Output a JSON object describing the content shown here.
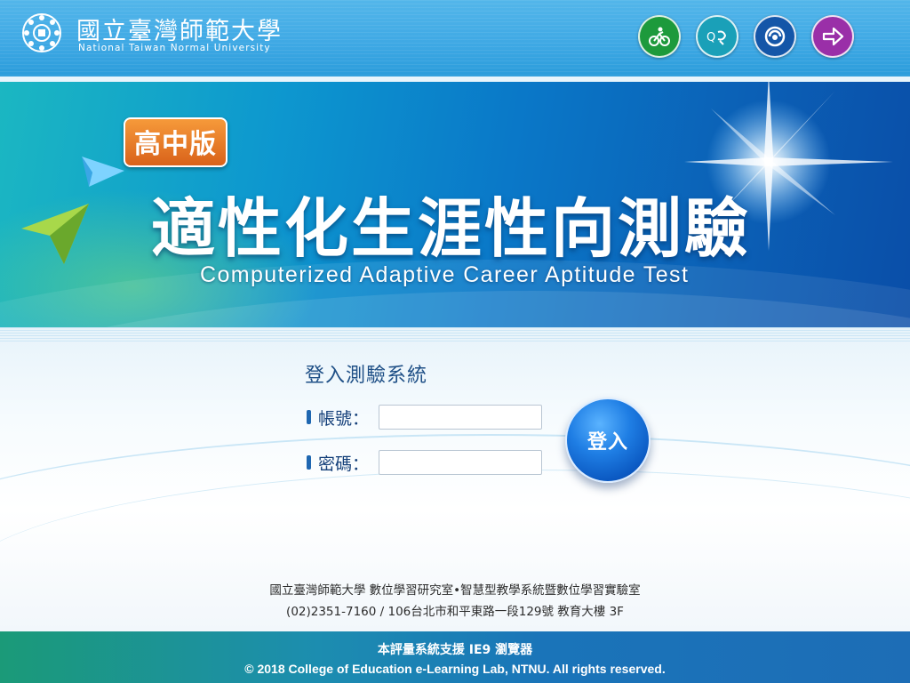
{
  "header": {
    "university_name_zh": "國立臺灣師範大學",
    "university_name_en": "National Taiwan Normal University",
    "nav_icons": [
      {
        "name": "green-circle-icon",
        "color": "#1d9a3c"
      },
      {
        "name": "teal-circle-icon",
        "color": "#1aa0b8"
      },
      {
        "name": "blue-circle-icon",
        "color": "#1456a8"
      },
      {
        "name": "purple-arrow-icon",
        "color": "#9a2fa8"
      }
    ]
  },
  "banner": {
    "edition_badge": "高中版",
    "title_zh": "適性化生涯性向測驗",
    "title_en": "Computerized Adaptive Career Aptitude Test"
  },
  "login": {
    "heading": "登入測驗系統",
    "account_label": "帳號：",
    "account_value": "",
    "password_label": "密碼：",
    "password_value": "",
    "submit_label": "登入"
  },
  "contact": {
    "organization": "國立臺灣師範大學 數位學習研究室•智慧型教學系統暨數位學習實驗室",
    "address": "(02)2351-7160 / 106台北市和平東路一段129號 教育大樓 3F"
  },
  "footer": {
    "browser_note": "本評量系統支援 IE9 瀏覽器",
    "copyright": "© 2018 College of Education e-Learning Lab, NTNU. All rights reserved."
  },
  "colors": {
    "brand_blue": "#0a78c8",
    "badge_orange": "#e06a1f",
    "button_blue": "#1f7ee4"
  }
}
